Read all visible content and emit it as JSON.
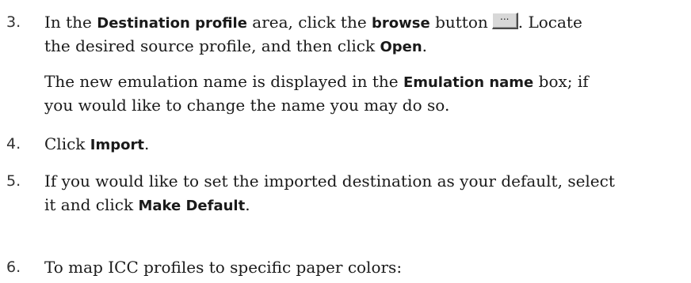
{
  "steps": [
    {
      "number": "3.",
      "lines": [
        {
          "t1": "In the ",
          "b1": "Destination profile",
          "t2": " area, click the ",
          "b2": "browse",
          "t3": " button",
          "t4": ". Locate"
        },
        {
          "t1": "the desired source profile, and then click ",
          "b1": "Open",
          "t2": "."
        }
      ],
      "note_lines": [
        {
          "t1": "The new emulation name is displayed in the ",
          "b1": "Emulation name",
          "t2": " box; if"
        },
        {
          "t1": "you would like to change the name you may do so."
        }
      ]
    },
    {
      "number": "4.",
      "lines": [
        {
          "t1": "Click ",
          "b1": "Import",
          "t2": "."
        }
      ]
    },
    {
      "number": "5.",
      "lines": [
        {
          "t1": "If you would like to set the imported destination as your default, select"
        },
        {
          "t1": "it and click ",
          "b1": "Make Default",
          "t2": "."
        }
      ]
    },
    {
      "number": "6.",
      "lines": [
        {
          "t1": "To map ICC profiles to specific paper colors:"
        }
      ]
    }
  ],
  "browse_button": {
    "icon": "ellipsis-icon",
    "label": "..."
  }
}
